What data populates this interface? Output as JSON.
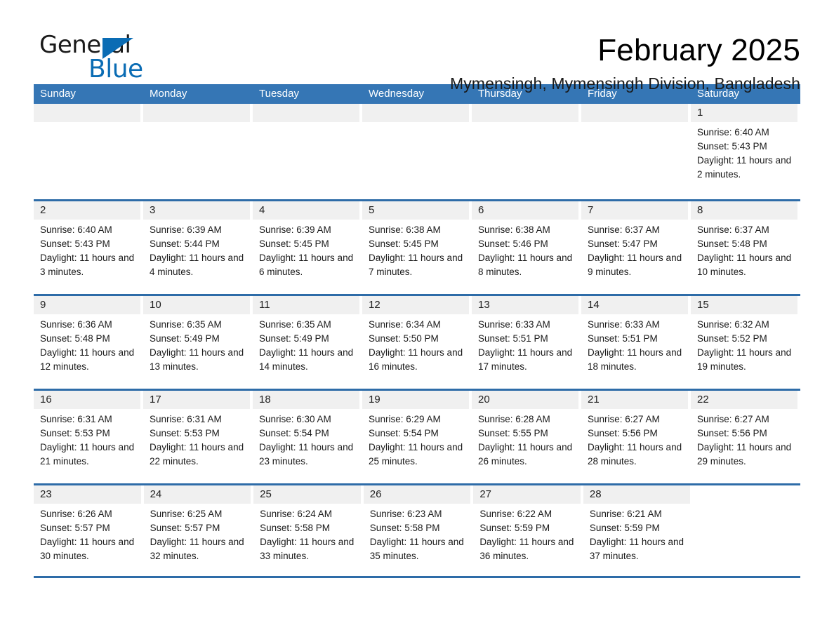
{
  "brand": {
    "name_part1": "General",
    "name_part2": "Blue",
    "triangle_color": "#0a6cb4"
  },
  "header": {
    "title": "February 2025",
    "subtitle": "Mymensingh, Mymensingh Division, Bangladesh",
    "accent_color": "#3576b5",
    "row_divider_color": "#2e6ca8",
    "day_band_color": "#f0f0f0"
  },
  "calendar": {
    "weekdays": [
      "Sunday",
      "Monday",
      "Tuesday",
      "Wednesday",
      "Thursday",
      "Friday",
      "Saturday"
    ],
    "weeks": [
      [
        {
          "day": "",
          "empty": true
        },
        {
          "day": "",
          "empty": true
        },
        {
          "day": "",
          "empty": true
        },
        {
          "day": "",
          "empty": true
        },
        {
          "day": "",
          "empty": true
        },
        {
          "day": "",
          "empty": true
        },
        {
          "day": "1",
          "sunrise": "Sunrise: 6:40 AM",
          "sunset": "Sunset: 5:43 PM",
          "daylight": "Daylight: 11 hours and 2 minutes."
        }
      ],
      [
        {
          "day": "2",
          "sunrise": "Sunrise: 6:40 AM",
          "sunset": "Sunset: 5:43 PM",
          "daylight": "Daylight: 11 hours and 3 minutes."
        },
        {
          "day": "3",
          "sunrise": "Sunrise: 6:39 AM",
          "sunset": "Sunset: 5:44 PM",
          "daylight": "Daylight: 11 hours and 4 minutes."
        },
        {
          "day": "4",
          "sunrise": "Sunrise: 6:39 AM",
          "sunset": "Sunset: 5:45 PM",
          "daylight": "Daylight: 11 hours and 6 minutes."
        },
        {
          "day": "5",
          "sunrise": "Sunrise: 6:38 AM",
          "sunset": "Sunset: 5:45 PM",
          "daylight": "Daylight: 11 hours and 7 minutes."
        },
        {
          "day": "6",
          "sunrise": "Sunrise: 6:38 AM",
          "sunset": "Sunset: 5:46 PM",
          "daylight": "Daylight: 11 hours and 8 minutes."
        },
        {
          "day": "7",
          "sunrise": "Sunrise: 6:37 AM",
          "sunset": "Sunset: 5:47 PM",
          "daylight": "Daylight: 11 hours and 9 minutes."
        },
        {
          "day": "8",
          "sunrise": "Sunrise: 6:37 AM",
          "sunset": "Sunset: 5:48 PM",
          "daylight": "Daylight: 11 hours and 10 minutes."
        }
      ],
      [
        {
          "day": "9",
          "sunrise": "Sunrise: 6:36 AM",
          "sunset": "Sunset: 5:48 PM",
          "daylight": "Daylight: 11 hours and 12 minutes."
        },
        {
          "day": "10",
          "sunrise": "Sunrise: 6:35 AM",
          "sunset": "Sunset: 5:49 PM",
          "daylight": "Daylight: 11 hours and 13 minutes."
        },
        {
          "day": "11",
          "sunrise": "Sunrise: 6:35 AM",
          "sunset": "Sunset: 5:49 PM",
          "daylight": "Daylight: 11 hours and 14 minutes."
        },
        {
          "day": "12",
          "sunrise": "Sunrise: 6:34 AM",
          "sunset": "Sunset: 5:50 PM",
          "daylight": "Daylight: 11 hours and 16 minutes."
        },
        {
          "day": "13",
          "sunrise": "Sunrise: 6:33 AM",
          "sunset": "Sunset: 5:51 PM",
          "daylight": "Daylight: 11 hours and 17 minutes."
        },
        {
          "day": "14",
          "sunrise": "Sunrise: 6:33 AM",
          "sunset": "Sunset: 5:51 PM",
          "daylight": "Daylight: 11 hours and 18 minutes."
        },
        {
          "day": "15",
          "sunrise": "Sunrise: 6:32 AM",
          "sunset": "Sunset: 5:52 PM",
          "daylight": "Daylight: 11 hours and 19 minutes."
        }
      ],
      [
        {
          "day": "16",
          "sunrise": "Sunrise: 6:31 AM",
          "sunset": "Sunset: 5:53 PM",
          "daylight": "Daylight: 11 hours and 21 minutes."
        },
        {
          "day": "17",
          "sunrise": "Sunrise: 6:31 AM",
          "sunset": "Sunset: 5:53 PM",
          "daylight": "Daylight: 11 hours and 22 minutes."
        },
        {
          "day": "18",
          "sunrise": "Sunrise: 6:30 AM",
          "sunset": "Sunset: 5:54 PM",
          "daylight": "Daylight: 11 hours and 23 minutes."
        },
        {
          "day": "19",
          "sunrise": "Sunrise: 6:29 AM",
          "sunset": "Sunset: 5:54 PM",
          "daylight": "Daylight: 11 hours and 25 minutes."
        },
        {
          "day": "20",
          "sunrise": "Sunrise: 6:28 AM",
          "sunset": "Sunset: 5:55 PM",
          "daylight": "Daylight: 11 hours and 26 minutes."
        },
        {
          "day": "21",
          "sunrise": "Sunrise: 6:27 AM",
          "sunset": "Sunset: 5:56 PM",
          "daylight": "Daylight: 11 hours and 28 minutes."
        },
        {
          "day": "22",
          "sunrise": "Sunrise: 6:27 AM",
          "sunset": "Sunset: 5:56 PM",
          "daylight": "Daylight: 11 hours and 29 minutes."
        }
      ],
      [
        {
          "day": "23",
          "sunrise": "Sunrise: 6:26 AM",
          "sunset": "Sunset: 5:57 PM",
          "daylight": "Daylight: 11 hours and 30 minutes."
        },
        {
          "day": "24",
          "sunrise": "Sunrise: 6:25 AM",
          "sunset": "Sunset: 5:57 PM",
          "daylight": "Daylight: 11 hours and 32 minutes."
        },
        {
          "day": "25",
          "sunrise": "Sunrise: 6:24 AM",
          "sunset": "Sunset: 5:58 PM",
          "daylight": "Daylight: 11 hours and 33 minutes."
        },
        {
          "day": "26",
          "sunrise": "Sunrise: 6:23 AM",
          "sunset": "Sunset: 5:58 PM",
          "daylight": "Daylight: 11 hours and 35 minutes."
        },
        {
          "day": "27",
          "sunrise": "Sunrise: 6:22 AM",
          "sunset": "Sunset: 5:59 PM",
          "daylight": "Daylight: 11 hours and 36 minutes."
        },
        {
          "day": "28",
          "sunrise": "Sunrise: 6:21 AM",
          "sunset": "Sunset: 5:59 PM",
          "daylight": "Daylight: 11 hours and 37 minutes."
        },
        {
          "day": "",
          "blank": true
        }
      ]
    ]
  }
}
